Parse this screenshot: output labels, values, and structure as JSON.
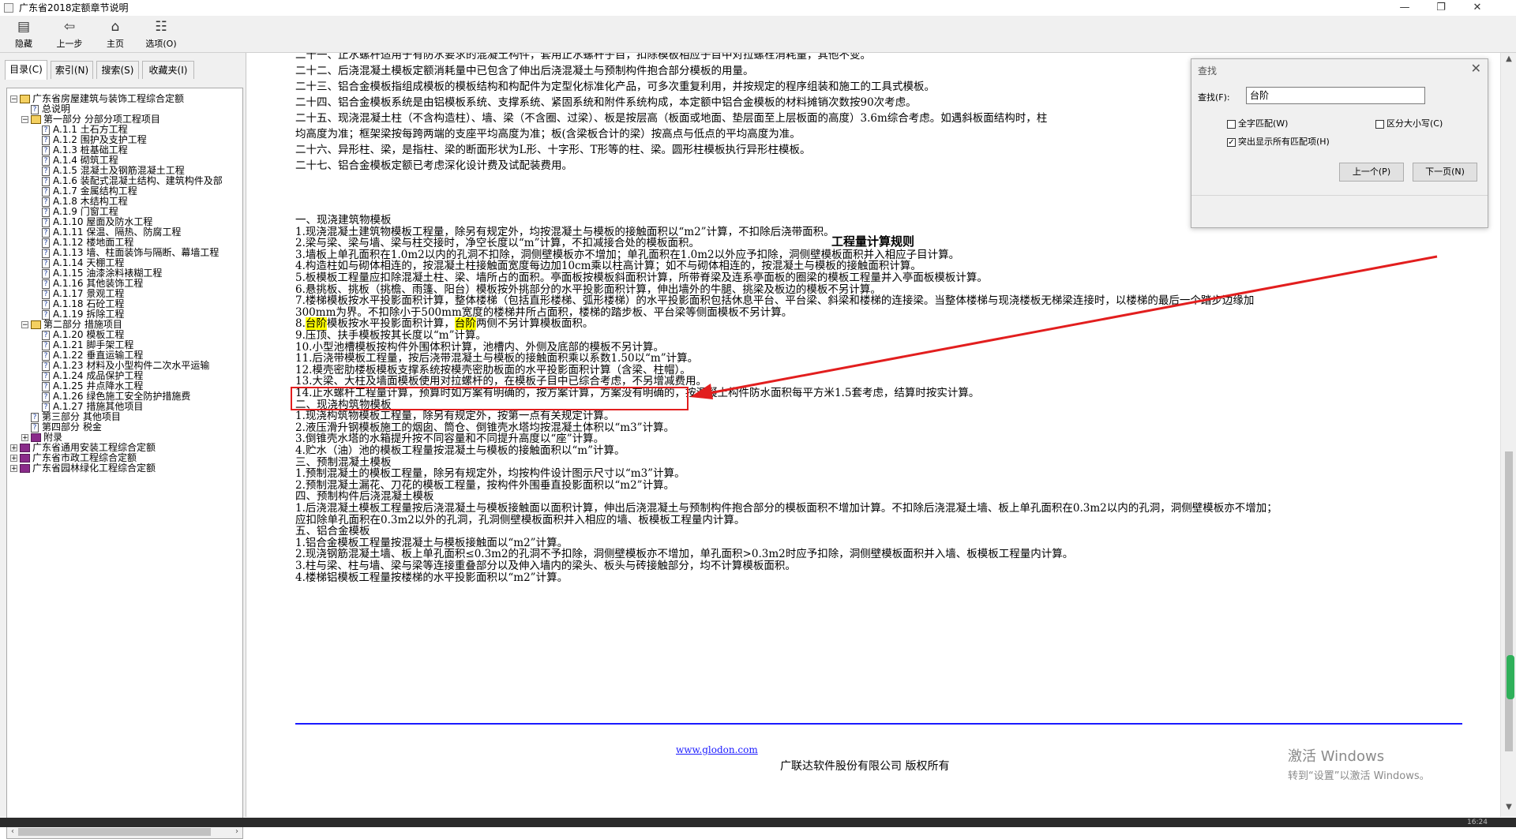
{
  "window": {
    "title": "广东省2018定额章节说明",
    "min": "—",
    "max": "❐",
    "close": "✕"
  },
  "toolbar": [
    {
      "label": "隐藏",
      "icon": "▤"
    },
    {
      "label": "上一步",
      "icon": "⇦"
    },
    {
      "label": "主页",
      "icon": "⌂"
    },
    {
      "label": "选项(O)",
      "icon": "☷"
    }
  ],
  "tabs": [
    "目录(C)",
    "索引(N)",
    "搜索(S)",
    "收藏夹(I)"
  ],
  "tree": [
    {
      "text": "广东省房屋建筑与装饰工程综合定额",
      "type": "book-open",
      "level": 0,
      "exp": "−"
    },
    {
      "text": "总说明",
      "type": "page",
      "level": 1
    },
    {
      "text": "第一部分  分部分项工程项目",
      "type": "book-open",
      "level": 1,
      "exp": "−"
    },
    {
      "text": "A.1.1 土石方工程",
      "type": "page",
      "level": 2
    },
    {
      "text": "A.1.2 围护及支护工程",
      "type": "page",
      "level": 2
    },
    {
      "text": "A.1.3 桩基础工程",
      "type": "page",
      "level": 2
    },
    {
      "text": "A.1.4 砌筑工程",
      "type": "page",
      "level": 2
    },
    {
      "text": "A.1.5 混凝土及钢筋混凝土工程",
      "type": "page",
      "level": 2
    },
    {
      "text": "A.1.6 装配式混凝土结构、建筑构件及部",
      "type": "page",
      "level": 2
    },
    {
      "text": "A.1.7 金属结构工程",
      "type": "page",
      "level": 2
    },
    {
      "text": "A.1.8 木结构工程",
      "type": "page",
      "level": 2
    },
    {
      "text": "A.1.9 门窗工程",
      "type": "page",
      "level": 2
    },
    {
      "text": "A.1.10 屋面及防水工程",
      "type": "page",
      "level": 2
    },
    {
      "text": "A.1.11 保温、隔热、防腐工程",
      "type": "page",
      "level": 2
    },
    {
      "text": "A.1.12 楼地面工程",
      "type": "page",
      "level": 2
    },
    {
      "text": "A.1.13 墙、柱面装饰与隔断、幕墙工程",
      "type": "page",
      "level": 2
    },
    {
      "text": "A.1.14 天棚工程",
      "type": "page",
      "level": 2
    },
    {
      "text": "A.1.15 油漆涂料裱糊工程",
      "type": "page",
      "level": 2
    },
    {
      "text": "A.1.16 其他装饰工程",
      "type": "page",
      "level": 2
    },
    {
      "text": "A.1.17 景观工程",
      "type": "page",
      "level": 2
    },
    {
      "text": "A.1.18 石砼工程",
      "type": "page",
      "level": 2
    },
    {
      "text": "A.1.19 拆除工程",
      "type": "page",
      "level": 2
    },
    {
      "text": "第二部分  措施项目",
      "type": "book-open",
      "level": 1,
      "exp": "−"
    },
    {
      "text": "A.1.20 模板工程",
      "type": "page",
      "level": 2
    },
    {
      "text": "A.1.21 脚手架工程",
      "type": "page",
      "level": 2
    },
    {
      "text": "A.1.22 垂直运输工程",
      "type": "page",
      "level": 2
    },
    {
      "text": "A.1.23 材料及小型构件二次水平运输",
      "type": "page",
      "level": 2
    },
    {
      "text": "A.1.24 成品保护工程",
      "type": "page",
      "level": 2
    },
    {
      "text": "A.1.25 井点降水工程",
      "type": "page",
      "level": 2
    },
    {
      "text": "A.1.26 绿色施工安全防护措施费",
      "type": "page",
      "level": 2
    },
    {
      "text": "A.1.27 措施其他项目",
      "type": "page",
      "level": 2
    },
    {
      "text": "第三部分  其他项目",
      "type": "page",
      "level": 1
    },
    {
      "text": "第四部分  税金",
      "type": "page",
      "level": 1
    },
    {
      "text": "附录",
      "type": "book-purple",
      "level": 1,
      "exp": "+"
    },
    {
      "text": "广东省通用安装工程综合定额",
      "type": "book-purple",
      "level": 0,
      "exp": "+"
    },
    {
      "text": "广东省市政工程综合定额",
      "type": "book-purple",
      "level": 0,
      "exp": "+"
    },
    {
      "text": "广东省园林绿化工程综合定额",
      "type": "book-purple",
      "level": 0,
      "exp": "+"
    }
  ],
  "content": {
    "top_lines": [
      "二十一、止水螺杆适用于有防水要求的混凝土构件，套用止水螺杆子目，扣除模板相应子目中对拉螺栓消耗量，其他不变。",
      "二十二、后浇混凝土模板定额消耗量中已包含了伸出后浇混凝土与预制构件抱合部分模板的用量。",
      "二十三、铝合金模板指组成模板的模板结构和构配件为定型化标准化产品，可多次重复利用，并按规定的程序组装和施工的工具式模板。",
      "二十四、铝合金模板系统是由铝模板系统、支撑系统、紧固系统和附件系统构成，本定额中铝合金模板的材料摊销次数按90次考虑。",
      "二十五、现浇混凝土柱（不含构造柱）、墙、梁（不含圈、过梁）、板是按层高（板面或地面、垫层面至上层板面的高度）3.6m综合考虑。如遇斜板面结构时，柱",
      "均高度为准；框架梁按每跨两端的支座平均高度为准；板(含梁板合计的梁）按高点与低点的平均高度为准。",
      "二十六、异形柱、梁，是指柱、梁的断面形状为L形、十字形、T形等的柱、梁。圆形柱模板执行异形柱模板。",
      "二十七、铝合金模板定额已考虑深化设计费及试配装费用。"
    ],
    "section_title": "工程量计算规则",
    "rule_lines_a": [
      "一、现浇建筑物模板",
      "1.现浇混凝土建筑物模板工程量，除另有规定外，均按混凝土与模板的接触面积以“m2”计算，不扣除后浇带面积。",
      "2.梁与梁、梁与墙、梁与柱交接时，净空长度以“m”计算，不扣减接合处的模板面积。",
      "3.墙板上单孔面积在1.0m2以内的孔洞不扣除，洞侧壁模板亦不增加；单孔面积在1.0m2以外应予扣除，洞侧壁模板面积并入相应子目计算。",
      "4.构造柱如与砌体相连的，按混凝土柱接触面宽度每边加10cm乘以柱高计算；如不与砌体相连的，按混凝土与模板的接触面积计算。",
      "5.板模板工程量应扣除混凝土柱、梁、墙所占的面积。亭面板按模板斜面积计算，所带脊梁及连系亭面板的圈梁的模板工程量并入亭面板模板计算。",
      "6.悬挑板、挑板（挑檐、雨篷、阳台）模板按外挑部分的水平投影面积计算，伸出墙外的牛腿、挑梁及板边的模板不另计算。",
      "7.楼梯模板按水平投影面积计算，整体楼梯（包括直形楼梯、弧形楼梯）的水平投影面积包括休息平台、平台梁、斜梁和楼梯的连接梁。当整体楼梯与现浇楼板无梯梁连接时，以楼梯的最后一个踏步边缘加",
      "300mm为界。不扣除小于500mm宽度的楼梯井所占面积，楼梯的踏步板、平台梁等侧面模板不另计算。"
    ],
    "rule8": {
      "n": "8.",
      "hl1": "台阶",
      "mid": "模板按水平投影面积计算，",
      "hl2": "台阶",
      "end": "两侧不另计算模板面积。"
    },
    "rule_lines_b": [
      "9.压顶、扶手模板按其长度以“m”计算。",
      "10.小型池槽模板按构件外围体积计算，池槽内、外侧及底部的模板不另计算。",
      "11.后浇带模板工程量，按后浇带混凝土与模板的接触面积乘以系数1.50以“m”计算。",
      "12.模壳密肋楼板模板支撑系统按模壳密肋板面的水平投影面积计算（含梁、柱帽）。",
      "13.大梁、大柱及墙面模板使用对拉螺杆的，在模板子目中已综合考虑，不另增减费用。",
      "14.止水螺杆工程量计算，预算时如方案有明确的，按方案计算，方案没有明确的，按混凝土构件防水面积每平方米1.5套考虑，结算时按实计算。",
      "二、现浇构筑物模板",
      "1.现浇构筑物模板工程量，除另有规定外，按第一点有关规定计算。",
      "2.液压滑升钢模板施工的烟囱、筒仓、倒锥壳水塔均按混凝土体积以“m3”计算。",
      "3.倒锥壳水塔的水箱提升按不同容量和不同提升高度以“座”计算。",
      "4.贮水（油）池的模板工程量按混凝土与模板的接触面积以“m”计算。",
      "三、预制混凝土模板",
      "1.预制混凝土的模板工程量，除另有规定外，均按构件设计图示尺寸以“m3”计算。",
      "2.预制混凝土漏花、刀花的模板工程量，按构件外围垂直投影面积以“m2”计算。",
      "四、预制构件后浇混凝土模板",
      "1.后浇混凝土模板工程量按后浇混凝土与模板接触面以面积计算，伸出后浇混凝土与预制构件抱合部分的模板面积不增加计算。不扣除后浇混凝土墙、板上单孔面积在0.3m2以内的孔洞，洞侧壁模板亦不增加；",
      "应扣除单孔面积在0.3m2以外的孔洞，孔洞侧壁模板面积并入相应的墙、板模板工程量内计算。",
      "五、铝合金模板",
      "1.铝合金模板工程量按混凝土与模板接触面以“m2”计算。",
      "2.现浇钢筋混凝土墙、板上单孔面积≤0.3m2的孔洞不予扣除，洞侧壁模板亦不增加，单孔面积>0.3m2时应予扣除，洞侧壁模板面积并入墙、板模板工程量内计算。",
      "3.柱与梁、柱与墙、梁与梁等连接重叠部分以及伸入墙内的梁头、板头与砖接触部分，均不计算模板面积。",
      "4.楼梯铝模板工程量按楼梯的水平投影面积以“m2”计算。"
    ],
    "footer_link": "www.glodon.com",
    "footer_copyright": "广联达软件股份有限公司 版权所有"
  },
  "find_dialog": {
    "title": "查找",
    "label": "查找(F):",
    "value": "台阶",
    "whole_word": "全字匹配(W)",
    "match_case": "区分大小写(C)",
    "highlight_all": "突出显示所有匹配项(H)",
    "prev": "上一个(P)",
    "next": "下一页(N)",
    "close": "✕"
  },
  "watermark": {
    "line1": "激活 Windows",
    "line2": "转到“设置”以激活 Windows。"
  },
  "status": {
    "time": "16:24"
  },
  "colors": {
    "highlight": "#ffff00",
    "annotation": "#e21e1e",
    "divider": "#1a1aff"
  }
}
